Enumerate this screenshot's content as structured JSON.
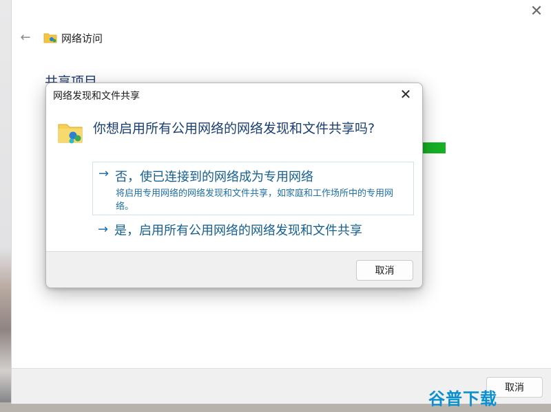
{
  "main_window": {
    "title": "网络访问",
    "heading": "共享项目",
    "footer_cancel": "取消"
  },
  "dialog": {
    "title": "网络发现和文件共享",
    "question": "你想启用所有公用网络的网络发现和文件共享吗?",
    "option_no": {
      "arrow": "→",
      "label": "否，使已连接到的网络成为专用网络",
      "description": "将启用专用网络的网络发现和文件共享，如家庭和工作场所中的专用网络。"
    },
    "option_yes": {
      "arrow": "→",
      "label": "是，启用所有公用网络的网络发现和文件共享"
    },
    "cancel": "取消"
  },
  "icons": {
    "close": "close-icon",
    "back": "back-arrow-icon",
    "network_folder": "network-folder-icon"
  },
  "watermark": "谷普下载",
  "colors": {
    "link": "#15608f",
    "heading": "#1e3b6c",
    "progress": "#16b024"
  }
}
